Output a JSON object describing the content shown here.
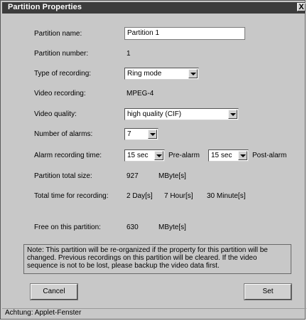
{
  "window": {
    "title": "Partition Properties",
    "close": "X"
  },
  "form": {
    "partition_name_label": "Partition name:",
    "partition_name_value": "Partition 1",
    "partition_number_label": "Partition number:",
    "partition_number_value": "1",
    "type_of_recording_label": "Type of recording:",
    "type_of_recording_value": "Ring mode",
    "video_recording_label": "Video recording:",
    "video_recording_value": "MPEG-4",
    "video_quality_label": "Video quality:",
    "video_quality_value": "high quality (CIF)",
    "number_of_alarms_label": "Number of alarms:",
    "number_of_alarms_value": "7",
    "alarm_recording_time_label": "Alarm recording time:",
    "pre_alarm_value": "15 sec",
    "pre_alarm_label": "Pre-alarm",
    "post_alarm_value": "15 sec",
    "post_alarm_label": "Post-alarm",
    "partition_total_size_label": "Partition total size:",
    "partition_total_size_value": "927",
    "partition_total_size_unit": "MByte[s]",
    "total_time_label": "Total time for recording:",
    "total_time_days": "2 Day[s]",
    "total_time_hours": "7 Hour[s]",
    "total_time_minutes": "30 Minute[s]",
    "free_label": "Free on this partition:",
    "free_value": "630",
    "free_unit": "MByte[s]"
  },
  "note": "Note: This partition will be re-organized if the property for this partition will be changed. Previous recordings on this partition will be cleared. If the video sequence is not to be lost, please backup the video data first.",
  "buttons": {
    "cancel": "Cancel",
    "set": "Set"
  },
  "status_bar": "Achtung: Applet-Fenster"
}
